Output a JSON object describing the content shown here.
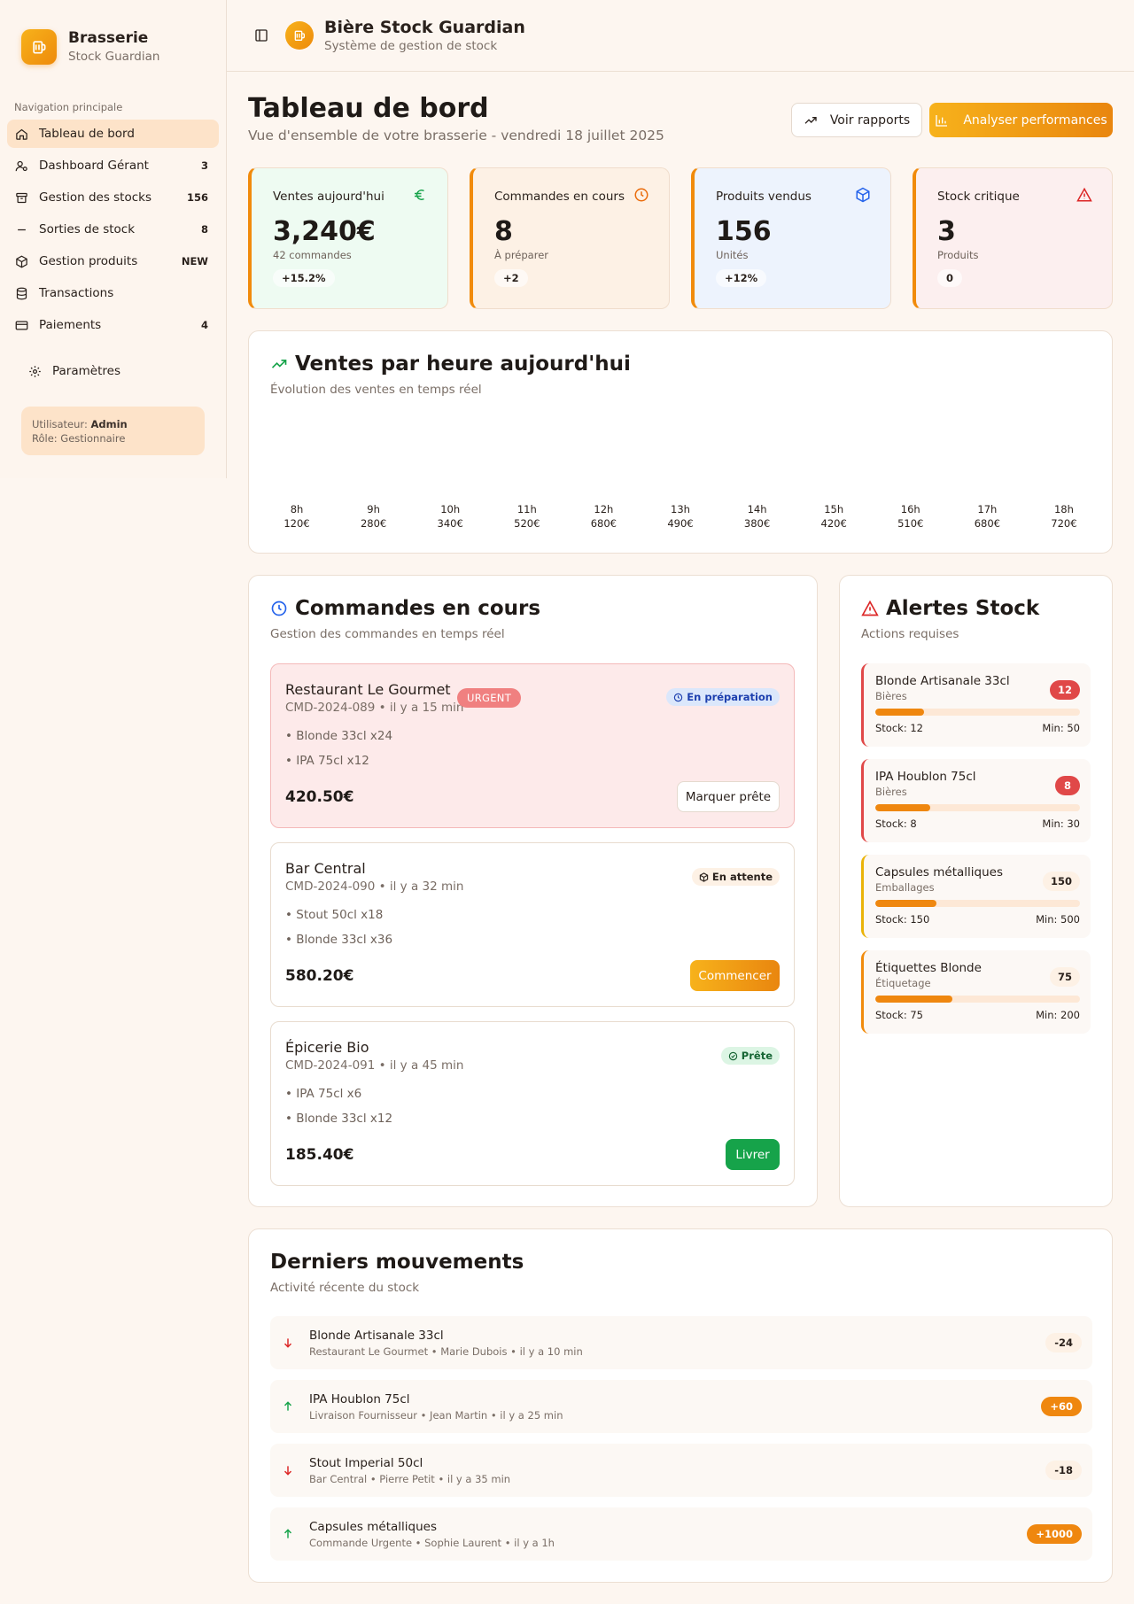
{
  "sidebar": {
    "brand_title": "Brasserie",
    "brand_sub": "Stock Guardian",
    "section_label": "Navigation principale",
    "items": [
      {
        "label": "Tableau de bord",
        "count": "",
        "icon": "home-icon"
      },
      {
        "label": "Dashboard Gérant",
        "count": "3",
        "icon": "user-cog-icon"
      },
      {
        "label": "Gestion des stocks",
        "count": "156",
        "icon": "archive-icon"
      },
      {
        "label": "Sorties de stock",
        "count": "8",
        "icon": "minus-icon"
      },
      {
        "label": "Gestion produits",
        "count": "NEW",
        "icon": "package-icon"
      },
      {
        "label": "Transactions",
        "count": "",
        "icon": "database-icon"
      },
      {
        "label": "Paiements",
        "count": "4",
        "icon": "credit-card-icon"
      }
    ],
    "settings_label": "Paramètres",
    "user_label": "Utilisateur:",
    "user_name": "Admin",
    "role_label": "Rôle: Gestionnaire"
  },
  "topbar": {
    "title": "Bière Stock Guardian",
    "subtitle": "Système de gestion de stock"
  },
  "header": {
    "title": "Tableau de bord",
    "subtitle": "Vue d'ensemble de votre brasserie - vendredi 18 juillet 2025",
    "reports_button": "Voir rapports",
    "analyze_button": "Analyser performances"
  },
  "stats": [
    {
      "label": "Ventes aujourd'hui",
      "value": "3,240€",
      "sub": "42 commandes",
      "badge": "+15.2%",
      "icon": "euro-icon"
    },
    {
      "label": "Commandes en cours",
      "value": "8",
      "sub": "À préparer",
      "badge": "+2",
      "icon": "clock-icon"
    },
    {
      "label": "Produits vendus",
      "value": "156",
      "sub": "Unités",
      "badge": "+12%",
      "icon": "box-icon"
    },
    {
      "label": "Stock critique",
      "value": "3",
      "sub": "Produits",
      "badge": "0",
      "icon": "alert-triangle-icon"
    }
  ],
  "sales_chart": {
    "title": "Ventes par heure aujourd'hui",
    "subtitle": "Évolution des ventes en temps réel"
  },
  "chart_data": {
    "type": "bar",
    "categories": [
      "8h",
      "9h",
      "10h",
      "11h",
      "12h",
      "13h",
      "14h",
      "15h",
      "16h",
      "17h",
      "18h"
    ],
    "value_labels": [
      "120€",
      "280€",
      "340€",
      "520€",
      "680€",
      "490€",
      "380€",
      "420€",
      "510€",
      "680€",
      "720€"
    ],
    "values": [
      120,
      280,
      340,
      520,
      680,
      490,
      380,
      420,
      510,
      680,
      720
    ],
    "title": "Ventes par heure aujourd'hui"
  },
  "orders": {
    "title": "Commandes en cours",
    "subtitle": "Gestion des commandes en temps réel",
    "urgent_label": "URGENT",
    "list": [
      {
        "name": "Restaurant Le Gourmet",
        "meta": "CMD-2024-089 • il y a 15 min",
        "status": "En préparation",
        "items": [
          "• Blonde 33cl x24",
          "• IPA 75cl x12"
        ],
        "total": "420.50€",
        "action": "Marquer prête"
      },
      {
        "name": "Bar Central",
        "meta": "CMD-2024-090 • il y a 32 min",
        "status": "En attente",
        "items": [
          "• Stout 50cl x18",
          "• Blonde 33cl x36"
        ],
        "total": "580.20€",
        "action": "Commencer"
      },
      {
        "name": "Épicerie Bio",
        "meta": "CMD-2024-091 • il y a 45 min",
        "status": "Prête",
        "items": [
          "• IPA 75cl x6",
          "• Blonde 33cl x12"
        ],
        "total": "185.40€",
        "action": "Livrer"
      }
    ]
  },
  "alerts": {
    "title": "Alertes Stock",
    "subtitle": "Actions requises",
    "list": [
      {
        "name": "Blonde Artisanale 33cl",
        "category": "Bières",
        "count": "12",
        "stock": "Stock: 12",
        "min": "Min: 50",
        "fill": 0.24
      },
      {
        "name": "IPA Houblon 75cl",
        "category": "Bières",
        "count": "8",
        "stock": "Stock: 8",
        "min": "Min: 30",
        "fill": 0.27
      },
      {
        "name": "Capsules métalliques",
        "category": "Emballages",
        "count": "150",
        "stock": "Stock: 150",
        "min": "Min: 500",
        "fill": 0.3
      },
      {
        "name": "Étiquettes Blonde",
        "category": "Étiquetage",
        "count": "75",
        "stock": "Stock: 75",
        "min": "Min: 200",
        "fill": 0.375
      }
    ]
  },
  "movements": {
    "title": "Derniers mouvements",
    "subtitle": "Activité récente du stock",
    "list": [
      {
        "name": "Blonde Artisanale 33cl",
        "meta": "Restaurant Le Gourmet • Marie Dubois • il y a 10 min",
        "qty": "-24",
        "direction": "out"
      },
      {
        "name": "IPA Houblon 75cl",
        "meta": "Livraison Fournisseur • Jean Martin • il y a 25 min",
        "qty": "+60",
        "direction": "in"
      },
      {
        "name": "Stout Imperial 50cl",
        "meta": "Bar Central • Pierre Petit • il y a 35 min",
        "qty": "-18",
        "direction": "out"
      },
      {
        "name": "Capsules métalliques",
        "meta": "Commande Urgente • Sophie Laurent • il y a 1h",
        "qty": "+1000",
        "direction": "in"
      }
    ]
  },
  "colors": {
    "accent": "#f18b0c",
    "danger": "#e04848",
    "success": "#16a34a",
    "info": "#2563eb"
  }
}
